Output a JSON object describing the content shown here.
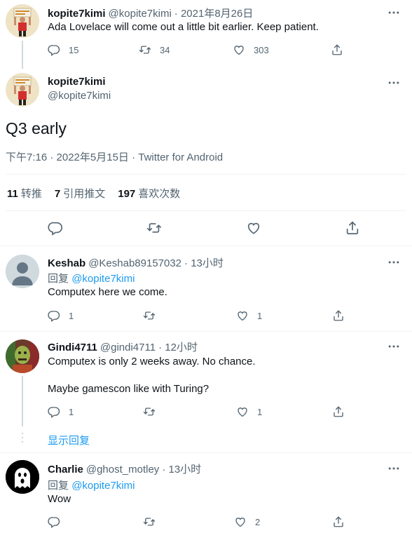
{
  "parent_tweet": {
    "author_name": "kopite7kimi",
    "author_handle": "@kopite7kimi",
    "date": "· 2021年8月26日",
    "text": "Ada Lovelace will come out a little bit earlier. Keep patient.",
    "reply_count": "15",
    "retweet_count": "34",
    "like_count": "303"
  },
  "main_tweet": {
    "author_name": "kopite7kimi",
    "author_handle": "@kopite7kimi",
    "text": "Q3 early",
    "meta": "下午7:16 · 2022年5月15日 · Twitter for Android",
    "stats": {
      "retweets_num": "11",
      "retweets_label": "转推",
      "quotes_num": "7",
      "quotes_label": "引用推文",
      "likes_num": "197",
      "likes_label": "喜欢次数"
    }
  },
  "replies": [
    {
      "author_name": "Keshab",
      "author_handle": "@Keshab89157032",
      "time": "· 13小时",
      "reply_to_prefix": "回复",
      "reply_to_handle": "@kopite7kimi",
      "text": "Computex here we come.",
      "reply_count": "1",
      "like_count": "1"
    },
    {
      "author_name": "Gindi4711",
      "author_handle": "@gindi4711",
      "time": "· 12小时",
      "text_line1": "Computex is only 2 weeks away. No chance.",
      "text_line2": "Maybe gamescon like with Turing?",
      "reply_count": "1",
      "like_count": "1",
      "show_replies": "显示回复"
    },
    {
      "author_name": "Charlie",
      "author_handle": "@ghost_motley",
      "time": "· 13小时",
      "reply_to_prefix": "回复",
      "reply_to_handle": "@kopite7kimi",
      "text": "Wow",
      "like_count": "2"
    }
  ],
  "colors": {
    "accent": "#1d9bf0",
    "secondary_text": "#536471",
    "divider": "#eff3f4"
  }
}
